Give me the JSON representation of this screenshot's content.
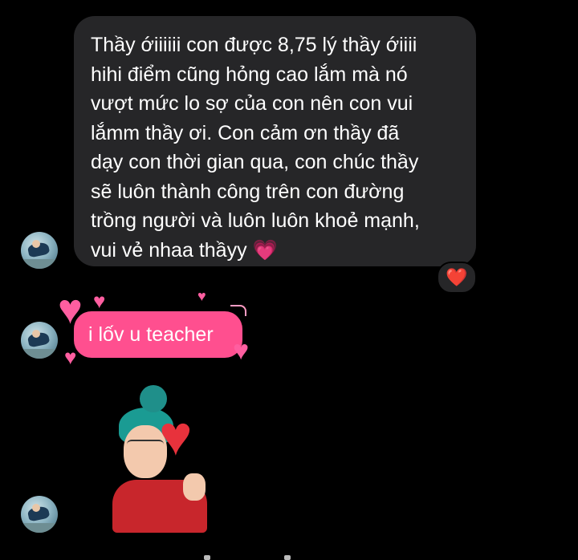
{
  "conversation": {
    "messages": [
      {
        "type": "text",
        "text": "Thầy ớiiiiii con được 8,75 lý thầy ớiiii\nhihi điểm cũng hỏng cao lắm mà nó\nvượt mức lo sợ của con nên con vui\nlắmm thầy ơi. Con cảm ơn thầy đã\ndạy con thời gian qua, con chúc thầy\nsẽ luôn thành công trên con đường\ntrồng người và luôn luôn khoẻ mạnh,\nvui vẻ nhaa thầyy 💗",
        "reaction": "❤️"
      },
      {
        "type": "text",
        "text": "i lốv u teacher",
        "effect": "hearts",
        "bubble_color": "#ff4f8f"
      },
      {
        "type": "sticker",
        "sticker": "avatar-heart-sticker"
      }
    ],
    "colors": {
      "background": "#000000",
      "incoming_bubble": "#262628",
      "reaction_heart": "#ff2d3f",
      "heart_accent": "#ff5ea0"
    },
    "icons": {
      "message_emoji": "pink-heart-emoji",
      "reaction": "red-heart-icon",
      "avatar": "contact-avatar"
    }
  }
}
